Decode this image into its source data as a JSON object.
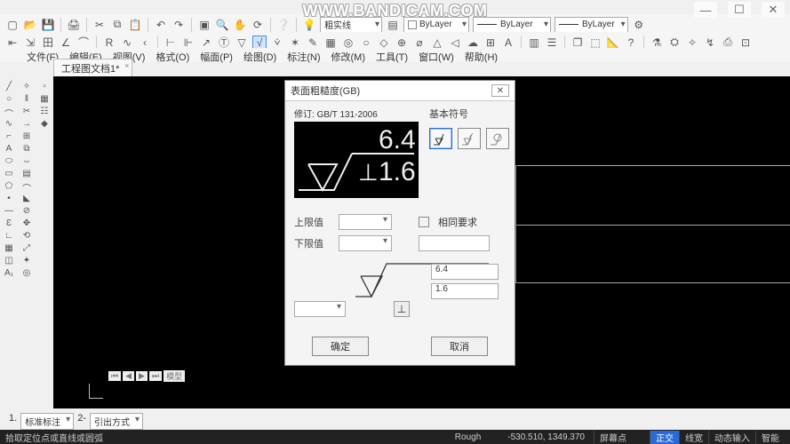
{
  "watermark": "WWW.BANDICAM.COM",
  "window_controls": {
    "min": "—",
    "max": "☐",
    "close": "✕"
  },
  "menus": [
    "文件(F)",
    "编辑(E)",
    "视图(V)",
    "格式(O)",
    "幅面(P)",
    "绘图(D)",
    "标注(N)",
    "修改(M)",
    "工具(T)",
    "窗口(W)",
    "帮助(H)"
  ],
  "combo1_label": "粗实线",
  "combo_bylayer1": "ByLayer",
  "combo_bylayer2": "ByLayer",
  "combo_bylayer3": "ByLayer",
  "doc_tab": "工程图文档1*",
  "bottom_nav": [
    "⏮",
    "◀",
    "▶",
    "⏭"
  ],
  "bottom_tab": "模型",
  "mode_dd1_prefix": "1.",
  "mode_dd1": "标准标注",
  "mode_dd2_prefix": "2-",
  "mode_dd2": "引出方式",
  "status_left": "拾取定位点或直线或圆弧",
  "status_tag": "Rough",
  "status_coords": "-530.510, 1349.370",
  "status_screen": "屏幕点",
  "status_cells": [
    "正交",
    "线宽",
    "动态输入",
    "智能"
  ],
  "dialog": {
    "title": "表面粗糙度(GB)",
    "revision_label": "修订:",
    "revision_value": "GB/T 131-2006",
    "symset_label": "基本符号",
    "upper_label": "上限值",
    "lower_label": "下限值",
    "same_req_label": "相同要求",
    "value_top": "6.4",
    "value_bottom": "1.6",
    "ok": "确定",
    "cancel": "取消"
  }
}
